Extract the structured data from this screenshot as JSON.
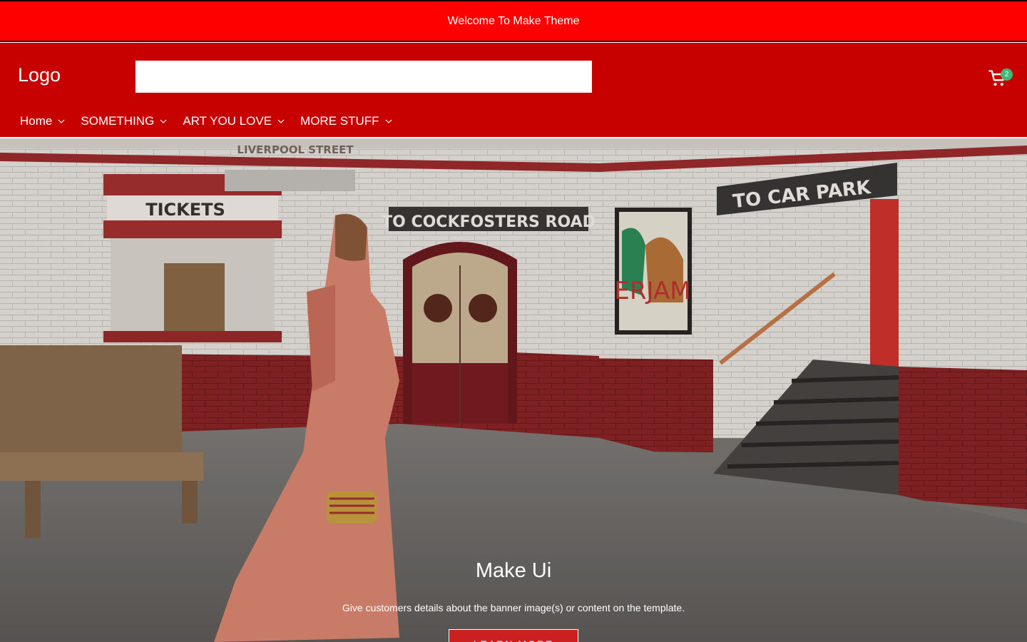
{
  "announcement": {
    "text": "Welcome To Make Theme"
  },
  "header": {
    "logo": "Logo",
    "search": {
      "value": "",
      "placeholder": ""
    },
    "cart": {
      "count": "2",
      "icon": "cart-icon"
    }
  },
  "nav": {
    "items": [
      {
        "label": "Home",
        "icon": "chevron-down-icon"
      },
      {
        "label": "SOMETHING",
        "icon": "chevron-down-icon"
      },
      {
        "label": "ART YOU LOVE",
        "icon": "chevron-down-icon"
      },
      {
        "label": "MORE STUFF",
        "icon": "chevron-down-icon"
      }
    ]
  },
  "hero": {
    "title": "Make Ui",
    "subtitle": "Give customers details about the banner image(s) or content on the template.",
    "button_label": "LEARN MORE",
    "image_signs": {
      "station": "LIVERPOOL STREET",
      "tickets": "TICKETS",
      "road": "TO COCKFOSTERS ROAD",
      "park": "TO CAR PARK",
      "poster": "ERJAM"
    }
  },
  "colors": {
    "announce_bg": "#ff0000",
    "header_bg": "#c70000",
    "badge": "#3cb878",
    "button_bg": "#cc1f1f"
  }
}
